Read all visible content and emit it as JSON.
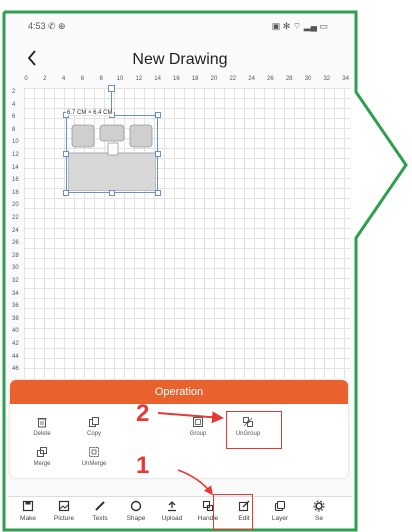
{
  "status_bar": {
    "time": "4:53 ✆ ⊕",
    "icons": "▣ ✻ ⌔ ▂▄ ▭"
  },
  "header": {
    "back_icon": "chevron-left-icon",
    "title": "New Drawing"
  },
  "ruler": {
    "top": [
      "0",
      "2",
      "4",
      "6",
      "8",
      "10",
      "12",
      "14",
      "16",
      "18",
      "20",
      "22",
      "24",
      "26",
      "28",
      "30",
      "32",
      "34"
    ],
    "left": [
      "2",
      "4",
      "6",
      "8",
      "10",
      "12",
      "14",
      "16",
      "18",
      "20",
      "22",
      "24",
      "26",
      "28",
      "30",
      "32",
      "34",
      "36",
      "38",
      "40",
      "42",
      "44",
      "46"
    ]
  },
  "shape": {
    "dimensions": "6.7 CM × 6.4 CM"
  },
  "operation_panel": {
    "title": "Operation",
    "buttons": [
      {
        "label": "Delete",
        "icon": "trash-icon"
      },
      {
        "label": "Copy",
        "icon": "copy-icon"
      },
      {
        "label": "Group",
        "icon": "group-icon"
      },
      {
        "label": "UnGroup",
        "icon": "ungroup-icon"
      },
      {
        "label": "Merge",
        "icon": "merge-icon"
      },
      {
        "label": "UnMerge",
        "icon": "unmerge-icon"
      }
    ]
  },
  "toolbar": {
    "items": [
      {
        "label": "Make",
        "icon": "save-icon"
      },
      {
        "label": "Picture",
        "icon": "picture-icon"
      },
      {
        "label": "Texts",
        "icon": "pen-icon"
      },
      {
        "label": "Shape",
        "icon": "circle-icon"
      },
      {
        "label": "Upload",
        "icon": "upload-icon"
      },
      {
        "label": "Handle",
        "icon": "handle-icon"
      },
      {
        "label": "Edit",
        "icon": "edit-icon"
      },
      {
        "label": "Layer",
        "icon": "layer-icon"
      },
      {
        "label": "Se",
        "icon": "settings-icon"
      }
    ]
  },
  "annotations": {
    "step1": "1",
    "step2": "2"
  },
  "colors": {
    "accent": "#e9622d",
    "highlight": "#e53935",
    "callout": "#2e9e4f",
    "selection": "#6a8fd6"
  }
}
